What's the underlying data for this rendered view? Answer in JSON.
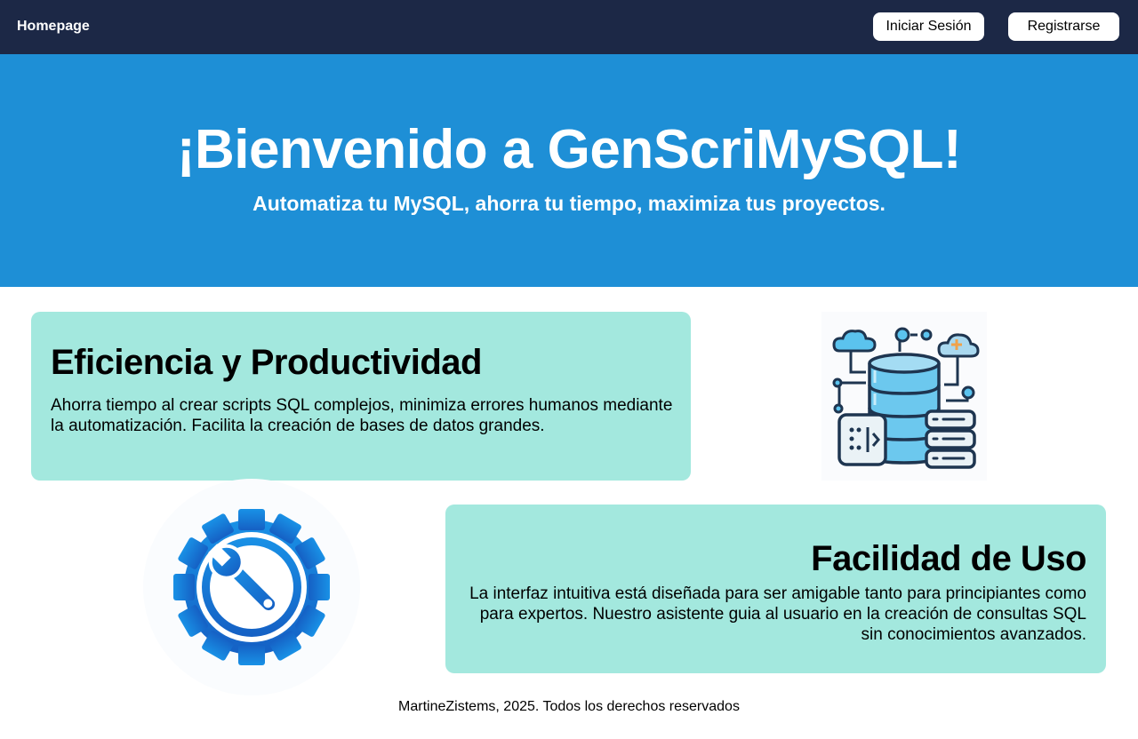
{
  "nav": {
    "brand": "Homepage",
    "login_label": "Iniciar Sesión",
    "register_label": "Registrarse"
  },
  "hero": {
    "title": "¡Bienvenido a GenScriMySQL!",
    "subtitle": "Automatiza tu MySQL, ahorra tu tiempo, maximiza tus proyectos."
  },
  "features": [
    {
      "title": "Eficiencia y Productividad",
      "text": "Ahorra tiempo al crear scripts SQL complejos, minimiza errores humanos mediante la automatización. Facilita la creación de bases de datos grandes."
    },
    {
      "title": "Facilidad de Uso",
      "text": "La interfaz intuitiva está diseñada para ser amigable tanto para principiantes como para expertos. Nuestro asistente guia al usuario en la creación de consultas SQL sin conocimientos avanzados."
    }
  ],
  "icons": {
    "database": "database-cloud-icon",
    "gear": "gear-wrench-icon"
  },
  "colors": {
    "navbar": "#1c2846",
    "hero": "#1e8fd6",
    "card": "#a3e8de",
    "gear_blue": "#1a73d1"
  },
  "footer": {
    "text": "MartineZistems, 2025. Todos los derechos reservados"
  }
}
